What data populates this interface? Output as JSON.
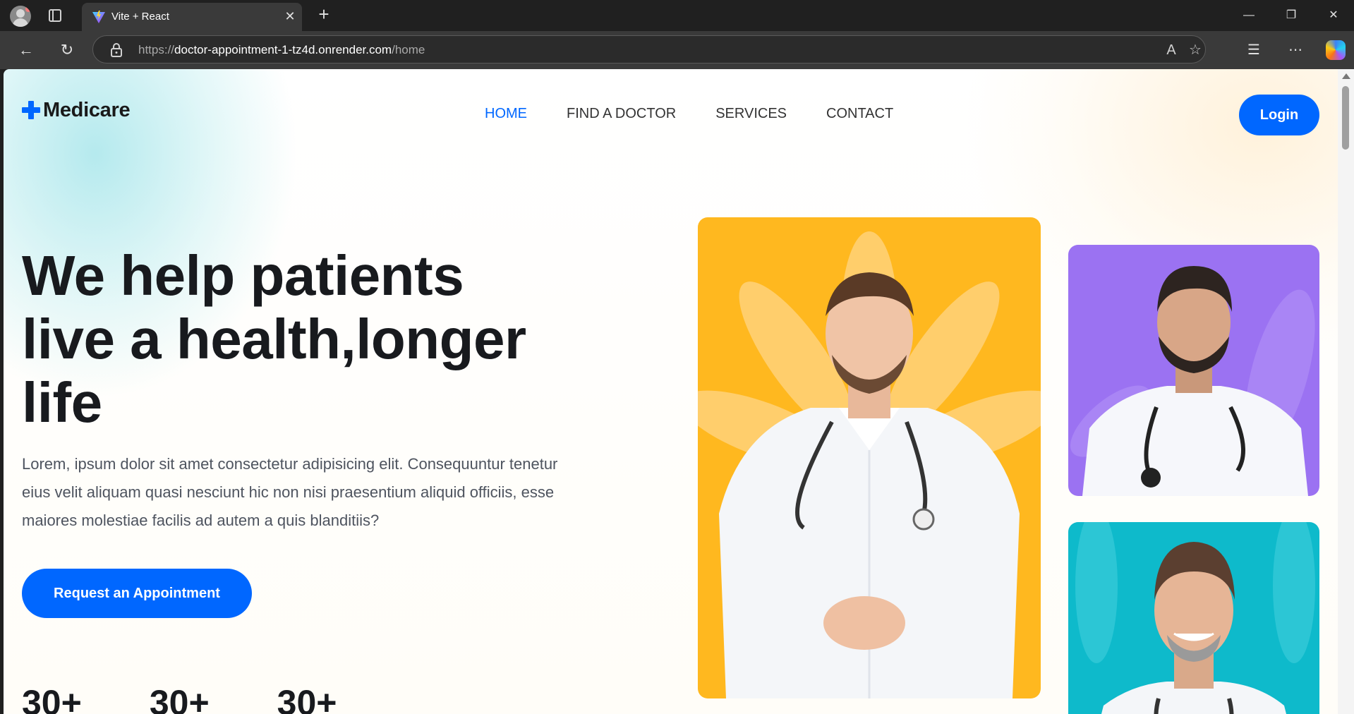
{
  "browser": {
    "tab_title": "Vite + React",
    "url_scheme": "https://",
    "url_host": "doctor-appointment-1-tz4d.onrender.com",
    "url_path": "/home",
    "icons": [
      "profile-icon",
      "tabs-icon",
      "close-icon",
      "new-tab-icon",
      "minimize-icon",
      "restore-icon",
      "window-close-icon",
      "back-icon",
      "reload-icon",
      "lock-icon",
      "read-aloud-icon",
      "favorite-icon",
      "favorites-icon",
      "more-icon",
      "copilot-icon"
    ]
  },
  "header": {
    "logo": "Medicare",
    "nav": [
      {
        "label": "HOME",
        "active": true
      },
      {
        "label": "FIND A DOCTOR",
        "active": false
      },
      {
        "label": "SERVICES",
        "active": false
      },
      {
        "label": "CONTACT",
        "active": false
      }
    ],
    "login_label": "Login"
  },
  "hero": {
    "title_line1": "We help patients",
    "title_line2": "live a health,longer",
    "title_line3": "life",
    "description": "Lorem, ipsum dolor sit amet consectetur adipisicing elit. Consequuntur tenetur eius velit aliquam quasi nesciunt hic non nisi praesentium aliquid officiis, esse maiores molestiae facilis ad autem a quis blanditiis?",
    "cta_label": "Request an Appointment",
    "stats": [
      "30+",
      "30+",
      "30+"
    ]
  },
  "colors": {
    "primary": "#0067ff",
    "card_yellow": "#ffb81f",
    "card_purple": "#9b72f2",
    "card_teal": "#0ebacb"
  }
}
